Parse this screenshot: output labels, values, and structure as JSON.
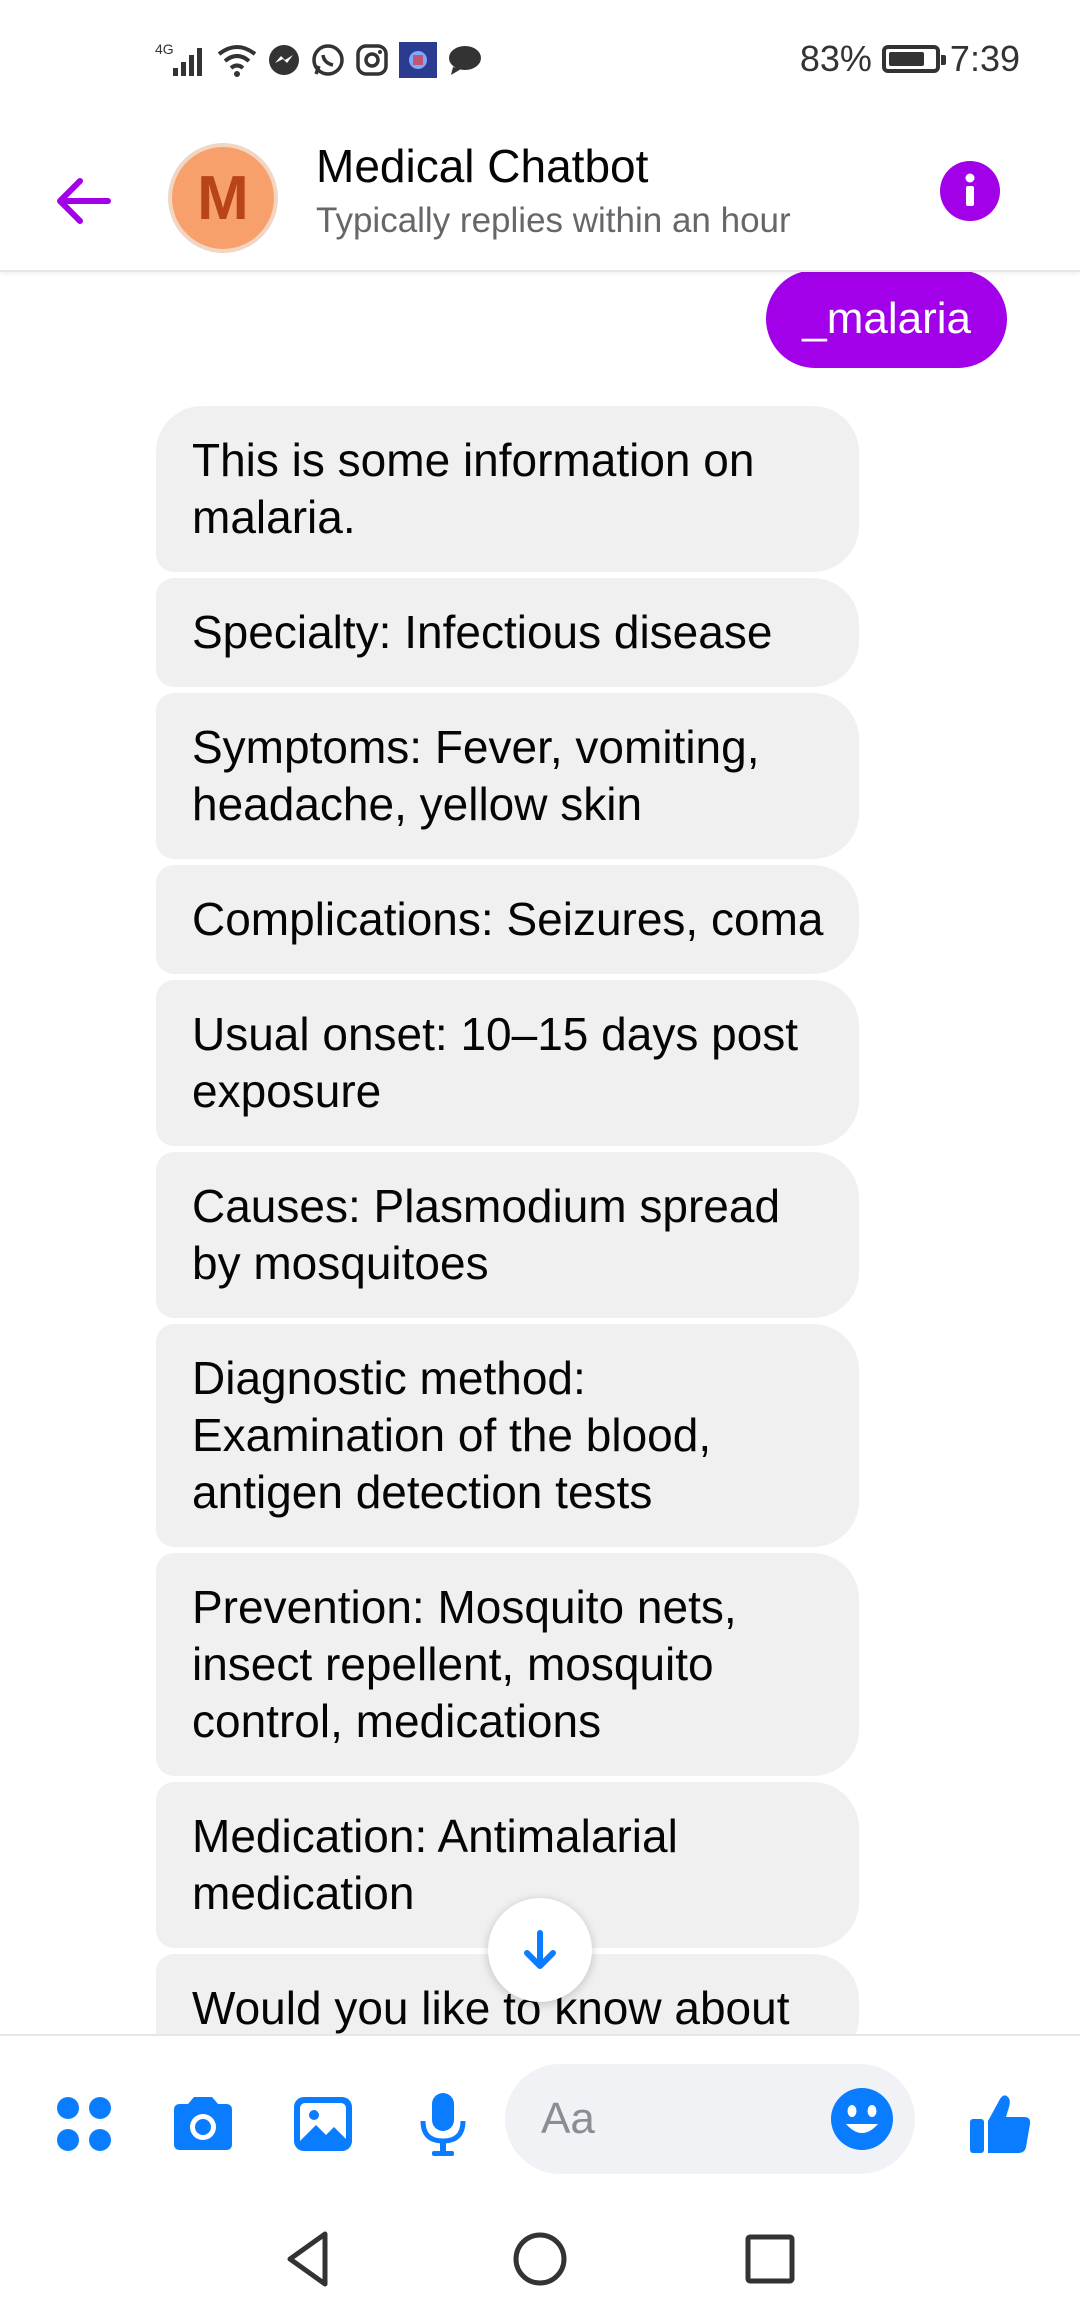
{
  "status_bar": {
    "battery": "83%",
    "battery_level": 0.83,
    "time": "7:39",
    "network": "4G",
    "icons": [
      "signal-icon",
      "wifi-icon",
      "messenger-notif-icon",
      "whatsapp-notif-icon",
      "instagram-notif-icon",
      "app-notif-icon",
      "chat-notif-icon"
    ]
  },
  "header": {
    "avatar_letter": "M",
    "title": "Medical Chatbot",
    "subtitle": "Typically replies within an hour",
    "accent_color": "#a200e8"
  },
  "messages": {
    "sent": "_malaria",
    "received": [
      "This is some information on\nmalaria.",
      "Specialty: Infectious disease",
      "Symptoms: Fever, vomiting,\nheadache, yellow skin",
      "Complications: Seizures, coma",
      "Usual onset: 10–15 days post\nexposure",
      "Causes: Plasmodium spread\nby mosquitoes",
      "Diagnostic method:\nExamination of the blood,\nantigen detection tests",
      "Prevention: Mosquito nets,\ninsect repellent, mosquito\ncontrol, medications",
      "Medication: Antimalarial\nmedication",
      "Would you like to know about"
    ]
  },
  "composer": {
    "placeholder": "Aa",
    "icon_color": "#0a7cff"
  },
  "nav": {
    "icons": [
      "back-nav-icon",
      "home-nav-icon",
      "recents-nav-icon"
    ]
  }
}
